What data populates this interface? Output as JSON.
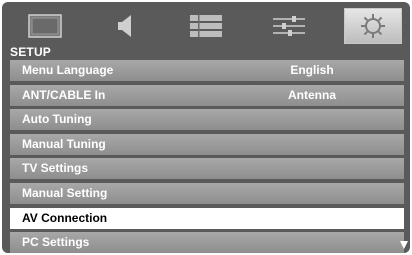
{
  "icons": [
    {
      "name": "picture-icon",
      "selected": false
    },
    {
      "name": "sound-icon",
      "selected": false
    },
    {
      "name": "channel-list-icon",
      "selected": false
    },
    {
      "name": "adjust-sliders-icon",
      "selected": false
    },
    {
      "name": "setup-gear-icon",
      "selected": true
    }
  ],
  "section": {
    "title": "SETUP"
  },
  "menu": {
    "items": [
      {
        "label": "Menu Language",
        "value": "English"
      },
      {
        "label": "ANT/CABLE In",
        "value": "Antenna"
      },
      {
        "label": "Auto Tuning",
        "value": ""
      },
      {
        "label": "Manual Tuning",
        "value": ""
      },
      {
        "label": "TV Settings",
        "value": ""
      },
      {
        "label": "Manual Setting",
        "value": ""
      },
      {
        "label": "AV Connection",
        "value": ""
      },
      {
        "label": "PC Settings",
        "value": ""
      }
    ],
    "highlighted_item": "AV Connection",
    "scroll_indicator": "down-arrow-icon"
  },
  "colors": {
    "panel": "#5a5a5a",
    "item": "#9b9b9b",
    "highlight": "#ffffff",
    "text": "#ffffff",
    "highlight_text": "#000000"
  }
}
